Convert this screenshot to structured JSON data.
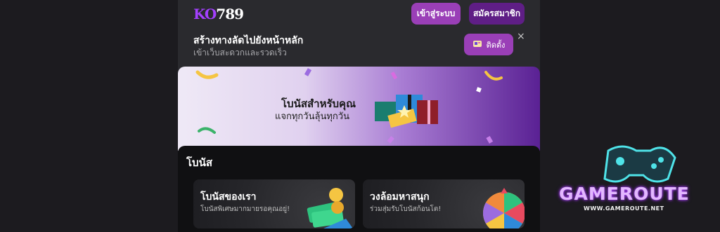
{
  "header": {
    "logo": {
      "brand_letters": "KO",
      "brand_number": "789",
      "tagline": ""
    },
    "login_label": "เข้าสู่ระบบ",
    "register_label": "สมัครสมาชิก"
  },
  "install_bar": {
    "title": "สร้างทางลัดไปยังหน้าหลัก",
    "subtitle": "เข้าเว็บสะดวกและรวดเร็ว",
    "install_label": "ติดตั้ง",
    "close_glyph": "×"
  },
  "banner": {
    "title": "โบนัสสำหรับคุณ",
    "subtitle": "แจกทุกวันลุ้นทุกวัน"
  },
  "bonus_section": {
    "title": "โบนัส",
    "cards": [
      {
        "title": "โบนัสของเรา",
        "subtitle": "โบนัสพิเศษมากมายรอคุณอยู่!"
      },
      {
        "title": "วงล้อมหาสนุก",
        "subtitle": "ร่วมสุ่มรับโบนัสก้อนโต!"
      }
    ]
  },
  "watermark": {
    "name": "GAMEROUTE",
    "url": "WWW.GAMEROUTE.NET"
  },
  "colors": {
    "page_bg": "#1c1b1f",
    "accent_purple": "#9a3fb7",
    "dark_purple": "#5f1e86",
    "panel_bg": "#101012"
  }
}
